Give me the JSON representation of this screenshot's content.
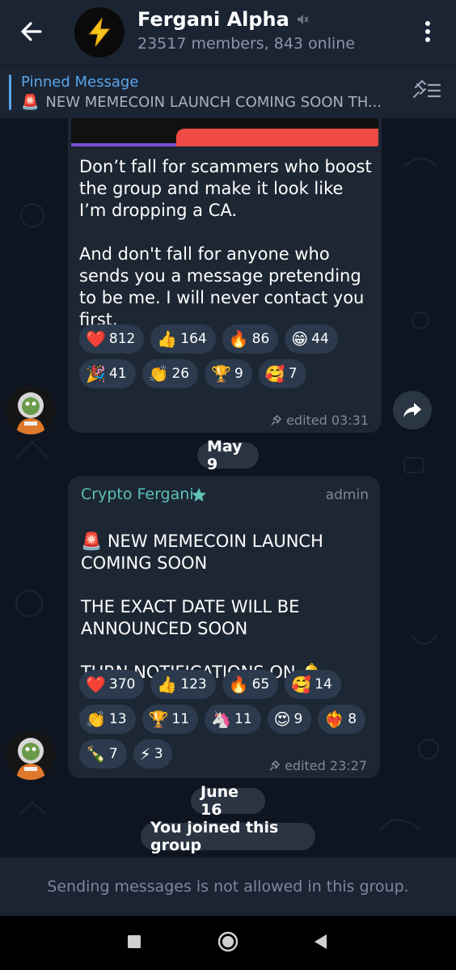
{
  "header": {
    "title": "Fergani Alpha",
    "subtitle": "23517 members, 843 online",
    "muted_icon": "muted-speaker-icon",
    "avatar_icon": "lightning-icon"
  },
  "pinned": {
    "title": "Pinned Message",
    "text": "NEW MEMECOIN LAUNCH COMING SOON  TH...",
    "emoji": "🚨"
  },
  "messages": [
    {
      "text": "Don’t fall for scammers who boost the group and make it look like I’m dropping a CA.\n\nAnd don't fall for anyone who sends you a message pretending to be me. I will never contact you first.",
      "reactions": [
        {
          "emoji": "❤️",
          "count": "812"
        },
        {
          "emoji": "👍",
          "count": "164"
        },
        {
          "emoji": "🔥",
          "count": "86"
        },
        {
          "emoji": "😁",
          "count": "44"
        },
        {
          "emoji": "🎉",
          "count": "41"
        },
        {
          "emoji": "👏",
          "count": "26"
        },
        {
          "emoji": "🏆",
          "count": "9"
        },
        {
          "emoji": "🥰",
          "count": "7"
        }
      ],
      "meta": "edited 03:31"
    },
    {
      "author": "Crypto Fergani",
      "role": "admin",
      "text_lead": "🚨",
      "text": "NEW MEMECOIN LAUNCH COMING SOON\n\nTHE EXACT DATE WILL BE ANNOUNCED SOON\n\nTURN NOTIFICATIONS ON 🔔",
      "reactions": [
        {
          "emoji": "❤️",
          "count": "370"
        },
        {
          "emoji": "👍",
          "count": "123"
        },
        {
          "emoji": "🔥",
          "count": "65"
        },
        {
          "emoji": "🥰",
          "count": "14"
        },
        {
          "emoji": "👏",
          "count": "13"
        },
        {
          "emoji": "🏆",
          "count": "11"
        },
        {
          "emoji": "🦄",
          "count": "11"
        },
        {
          "emoji": "😍",
          "count": "9"
        },
        {
          "emoji": "❤️‍🔥",
          "count": "8"
        },
        {
          "emoji": "🍾",
          "count": "7"
        },
        {
          "emoji": "⚡",
          "count": "3"
        }
      ],
      "meta": "edited 23:27"
    }
  ],
  "dates": {
    "first": "May 9",
    "second": "June 16"
  },
  "service": "You joined this group",
  "bottom_notice": "Sending messages is not allowed in this group.",
  "colors": {
    "accent": "#5aa6e8",
    "admin_name": "#5cc2b8",
    "bubble": "#1d2633",
    "reaction": "#2b3a4d"
  }
}
